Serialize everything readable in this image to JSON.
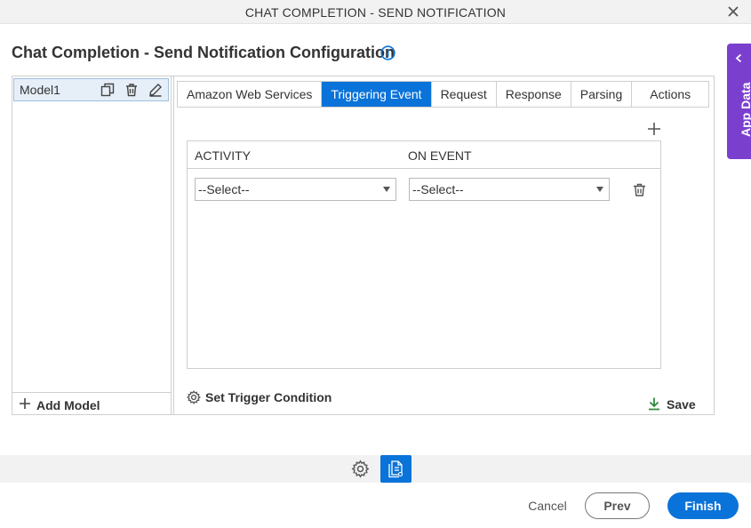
{
  "window": {
    "title": "CHAT COMPLETION - SEND NOTIFICATION",
    "close_icon": "close-icon"
  },
  "page": {
    "heading": "Chat Completion - Send Notification Configuration",
    "info_icon": "info-icon"
  },
  "app_data": {
    "label": "App Data",
    "icon": "chevron-left-icon",
    "color": "#7b3fce"
  },
  "models": {
    "items": [
      {
        "name": "Model1",
        "icons": [
          "copy-icon",
          "trash-icon",
          "edit-icon"
        ]
      }
    ],
    "add_label": "Add Model"
  },
  "tabs": [
    {
      "label": "Amazon Web Services",
      "active": false
    },
    {
      "label": "Triggering Event",
      "active": true
    },
    {
      "label": "Request",
      "active": false
    },
    {
      "label": "Response",
      "active": false
    },
    {
      "label": "Parsing",
      "active": false
    },
    {
      "label": "Actions",
      "active": false
    }
  ],
  "grid": {
    "columns": [
      "ACTIVITY",
      "ON EVENT"
    ],
    "rows": [
      {
        "activity": "--Select--",
        "on_event": "--Select--"
      }
    ]
  },
  "footer_actions": {
    "trigger_label": "Set Trigger Condition",
    "save_label": "Save"
  },
  "buttons": {
    "cancel": "Cancel",
    "prev": "Prev",
    "finish": "Finish"
  },
  "colors": {
    "accent": "#0a73d9",
    "save_green": "#2e8b3e",
    "app_data": "#7b3fce"
  }
}
